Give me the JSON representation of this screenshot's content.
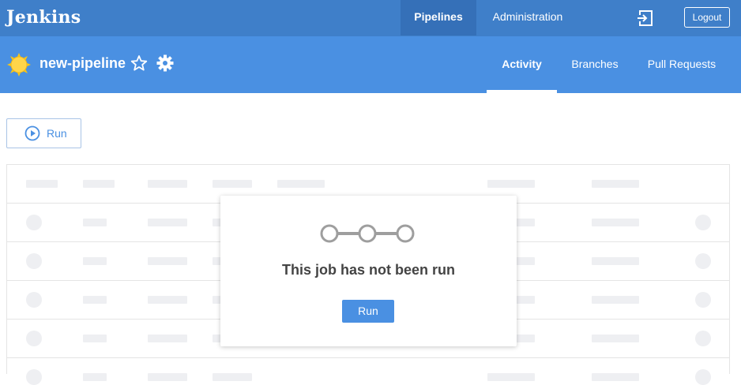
{
  "colors": {
    "topbar": "#3f7fc9",
    "subbar": "#4a90e2",
    "accent": "#4a90e2",
    "placeholder": "#eeeff2"
  },
  "topbar": {
    "brand": "Jenkins",
    "nav": [
      {
        "label": "Pipelines",
        "active": true
      },
      {
        "label": "Administration",
        "active": false
      }
    ],
    "exit_icon": "exit-icon",
    "logout_label": "Logout"
  },
  "pipeline": {
    "status_icon": "sun-icon",
    "name": "new-pipeline",
    "favorite_icon": "star-outline-icon",
    "settings_icon": "gear-icon",
    "tabs": [
      {
        "label": "Activity",
        "active": true
      },
      {
        "label": "Branches",
        "active": false
      },
      {
        "label": "Pull Requests",
        "active": false
      }
    ]
  },
  "toolbar": {
    "run_label": "Run",
    "run_icon": "play-circle-icon"
  },
  "empty_state": {
    "icon": "pipeline-stages-icon",
    "message": "This job has not been run",
    "run_label": "Run"
  }
}
